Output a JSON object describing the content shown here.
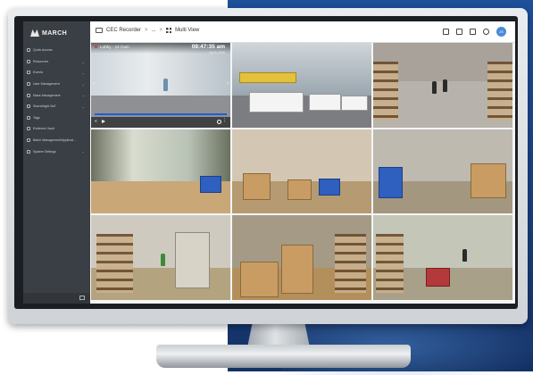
{
  "colors": {
    "sidebar": "#3a3f45",
    "accent": "#1f5fd1",
    "avatar": "#4a8ad8",
    "backdrop": "#1d4f9a"
  },
  "brand": {
    "logo_text": "MARCH",
    "logo_icon": "march-logo-icon"
  },
  "sidebar": {
    "items": [
      {
        "label": "Quick Access",
        "icon": "star-icon"
      },
      {
        "label": "Resources",
        "icon": "folder-icon",
        "chevron": true
      },
      {
        "label": "Events",
        "icon": "bell-icon",
        "chevron": true
      },
      {
        "label": "User Management",
        "icon": "users-icon",
        "chevron": true
      },
      {
        "label": "Mass Management",
        "icon": "server-icon",
        "chevron": true
      },
      {
        "label": "Searchlight VuE",
        "icon": "chart-icon",
        "chevron": true
      },
      {
        "label": "Tags",
        "icon": "tag-icon"
      },
      {
        "label": "Evidence Vault",
        "icon": "vault-icon"
      },
      {
        "label": "Batch Management/Applicat...",
        "icon": "batch-icon"
      },
      {
        "label": "System Settings",
        "icon": "gear-icon",
        "chevron": true
      }
    ]
  },
  "breadcrumb": {
    "root": "CEC Recorder",
    "sep": ">",
    "middle": "...",
    "current": "Multi View"
  },
  "toolbar": {
    "icons": [
      "edit-icon",
      "copy-icon",
      "trash-icon",
      "help-icon"
    ],
    "avatar_initials": "JS"
  },
  "active_camera": {
    "title": "Lobby - 12 Cam",
    "time": "08:47:35 am",
    "date": "Apr 8, 2020"
  }
}
